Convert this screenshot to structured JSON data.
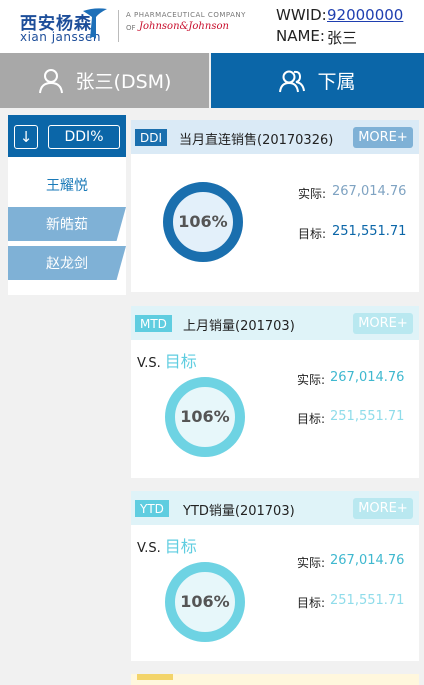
{
  "header": {
    "logo_cn": "西安杨森",
    "logo_en": "xian janssen",
    "pharma_line": "A PHARMACEUTICAL COMPANY",
    "of_text": "OF",
    "jj_text": "Johnson&Johnson",
    "wwid_label": "WWID:",
    "wwid_value": "92000000",
    "name_label": "NAME:",
    "name_value": "张三"
  },
  "tabs": {
    "self_label": "张三(DSM)",
    "sub_label": "下属"
  },
  "side": {
    "ddi_label": "DDI%",
    "items": [
      {
        "label": "王耀悦"
      },
      {
        "label": "新皓茹"
      },
      {
        "label": "赵龙剑"
      }
    ]
  },
  "cards": [
    {
      "badge": "DDI",
      "title": "当月直连销售(20170326)",
      "more": "MORE+",
      "percent": "106%",
      "actual_label": "实际:",
      "actual_value": "267,014.76",
      "target_label": "目标:",
      "target_value": "251,551.71"
    },
    {
      "badge": "MTD",
      "title": "上月销量(201703)",
      "more": "MORE+",
      "vs": "V.S.",
      "vs_target": "目标",
      "percent": "106%",
      "actual_label": "实际:",
      "actual_value": "267,014.76",
      "target_label": "目标:",
      "target_value": "251,551.71"
    },
    {
      "badge": "YTD",
      "title": "YTD销量(201703)",
      "more": "MORE+",
      "vs": "V.S.",
      "vs_target": "目标",
      "percent": "106%",
      "actual_label": "实际:",
      "actual_value": "267,014.76",
      "target_label": "目标:",
      "target_value": "251,551.71"
    }
  ],
  "colors": {
    "brand_blue": "#0b66a8",
    "cyan": "#5fcde0",
    "tab_grey": "#a8a8a8"
  }
}
